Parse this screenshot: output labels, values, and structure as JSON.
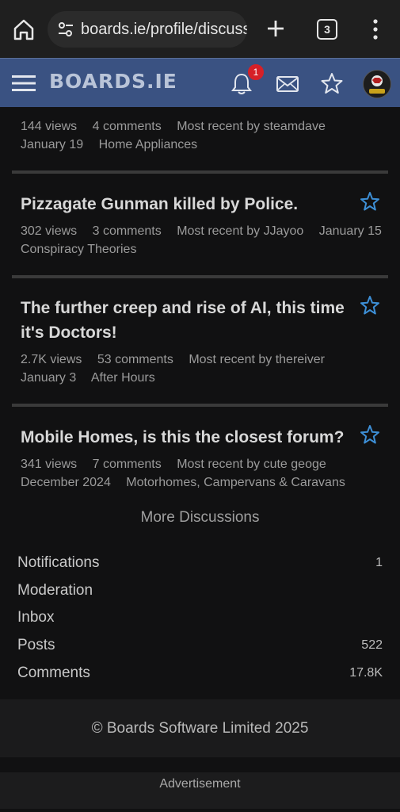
{
  "browser": {
    "url": "boards.ie/profile/discuss",
    "tab_count": "3"
  },
  "header": {
    "logo": "BOARDS.IE",
    "notification_badge": "1"
  },
  "discussions": [
    {
      "title": "",
      "views": "144 views",
      "comments": "4 comments",
      "recent": "Most recent by steamdave",
      "date": "January 19",
      "category": "Home Appliances"
    },
    {
      "title": "Pizzagate Gunman killed by Police.",
      "views": "302 views",
      "comments": "3 comments",
      "recent": "Most recent by JJayoo",
      "date": "January 15",
      "category": "Conspiracy Theories"
    },
    {
      "title": "The further creep and rise of AI, this time it's Doctors!",
      "views": "2.7K views",
      "comments": "53 comments",
      "recent": "Most recent by thereiver",
      "date": "January 3",
      "category": "After Hours"
    },
    {
      "title": "Mobile Homes, is this the closest forum?",
      "views": "341 views",
      "comments": "7 comments",
      "recent": "Most recent by cute geoge",
      "date": "December 2024",
      "category": "Motorhomes, Campervans & Caravans"
    }
  ],
  "more_discussions": "More Discussions",
  "profile_stats": [
    {
      "label": "Notifications",
      "count": "1"
    },
    {
      "label": "Moderation",
      "count": ""
    },
    {
      "label": "Inbox",
      "count": ""
    },
    {
      "label": "Posts",
      "count": "522"
    },
    {
      "label": "Comments",
      "count": "17.8K"
    }
  ],
  "footer": {
    "copyright": "© Boards Software Limited 2025",
    "advertisement": "Advertisement"
  },
  "colors": {
    "header_bg": "#3a5282",
    "star_blue": "#3d8fd6",
    "badge_red": "#d62027",
    "page_bg": "#111112"
  }
}
